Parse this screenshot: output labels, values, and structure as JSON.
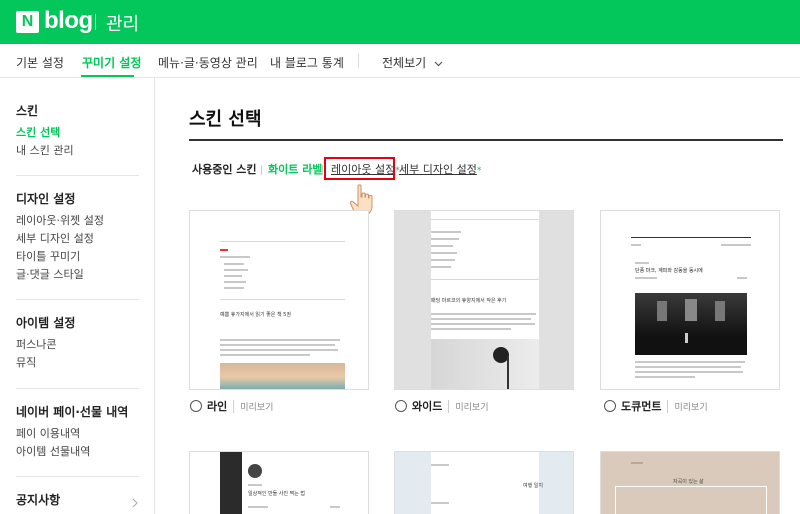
{
  "header": {
    "logo_mark": "N",
    "logo_text": "blog",
    "section_title": "관리"
  },
  "tabs": [
    {
      "label": "기본 설정"
    },
    {
      "label": "꾸미기 설정"
    },
    {
      "label": "메뉴·글·동영상 관리"
    },
    {
      "label": "내 블로그 통계"
    },
    {
      "label": "전체보기"
    }
  ],
  "sidebar": {
    "groups": [
      {
        "heading": "스킨",
        "items": [
          "스킨 선택",
          "내 스킨 관리"
        ]
      },
      {
        "heading": "디자인 설정",
        "items": [
          "레이아웃·위젯 설정",
          "세부 디자인 설정",
          "타이틀 꾸미기",
          "글·댓글 스타일"
        ]
      },
      {
        "heading": "아이템 설정",
        "items": [
          "퍼스나콘",
          "뮤직"
        ]
      },
      {
        "heading": "네이버 페이·선물 내역",
        "items": [
          "페이 이용내역",
          "아이템 선물내역"
        ]
      },
      {
        "heading": "공지사항",
        "items": []
      }
    ]
  },
  "main": {
    "title": "스킨 선택",
    "subnav": {
      "label": "사용중인 스킨",
      "current_skin": "화이트 라벨",
      "layout_link": "레이아웃 설정",
      "detail_link": "세부 디자인 설정",
      "asterisk": "*"
    },
    "preview_label": "미리보기",
    "skins": [
      {
        "name": "라인"
      },
      {
        "name": "와이드"
      },
      {
        "name": "도큐먼트"
      }
    ],
    "card_texts": {
      "line_post_title": "예쁨 휴가지에서 읽기 좋은 책 5권",
      "wide_post_title": "패딩 마르코의 휴양지에서 작은 후기",
      "document_post_title": "단풍 마크, 계피와 감동을 동시에",
      "bottom_left_post_title": "일상적인 만들 사진 찍는 법",
      "bottom_middle_post_title": "여행 일지",
      "bottom_right_post_title": "자곡이 있는 삶"
    }
  },
  "colors": {
    "brand": "#03c75a",
    "highlight_box": "#e60012"
  }
}
